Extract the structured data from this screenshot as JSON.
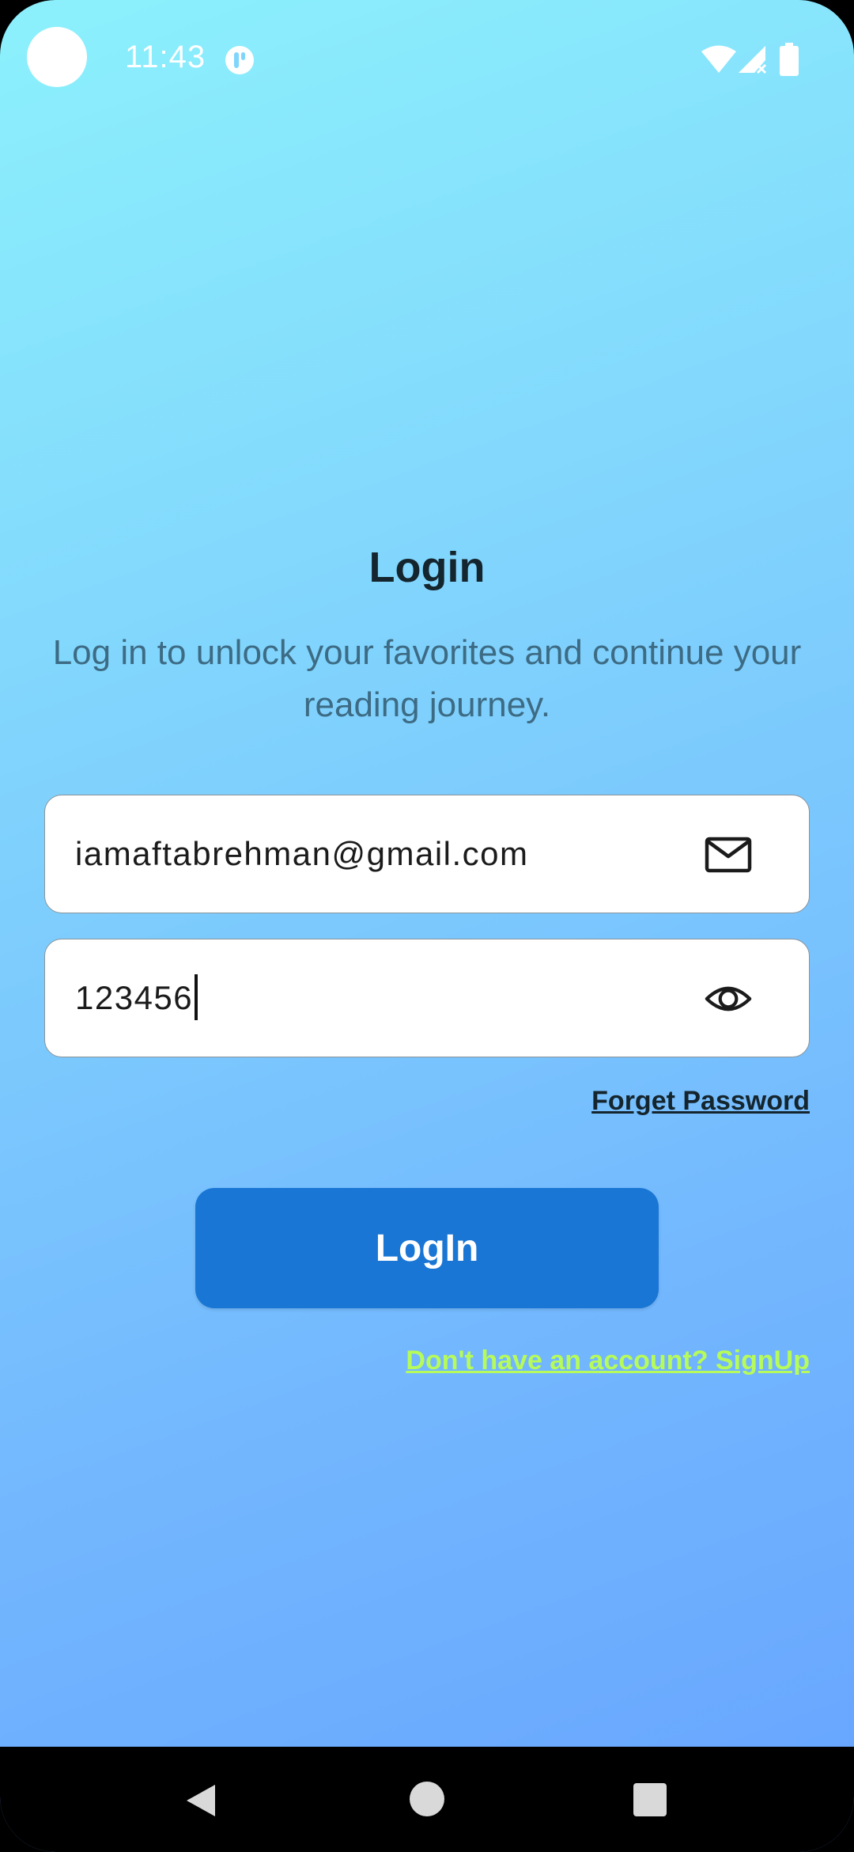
{
  "status_bar": {
    "time": "11:43",
    "icons": [
      "camera-cutout",
      "app-notification-icon",
      "wifi-icon",
      "signal-icon",
      "battery-icon"
    ]
  },
  "login": {
    "title": "Login",
    "subtitle": "Log in to unlock your favorites and continue your reading journey.",
    "email_value": "iamaftabrehman@gmail.com",
    "email_icon": "mail-icon",
    "password_value": "123456",
    "password_icon": "eye-icon",
    "forget_password": "Forget Password",
    "login_button": "LogIn",
    "signup_link": "Don't have an account? SignUp"
  },
  "nav_bar": {
    "icons": [
      "back-icon",
      "home-icon",
      "recents-icon"
    ]
  },
  "colors": {
    "background_top": "#8cf1fc",
    "background_bottom": "#67a4ff",
    "button": "#1976d4",
    "signup_link": "#b6fb5a",
    "title": "#14252e",
    "subtitle": "#3d6b84"
  }
}
